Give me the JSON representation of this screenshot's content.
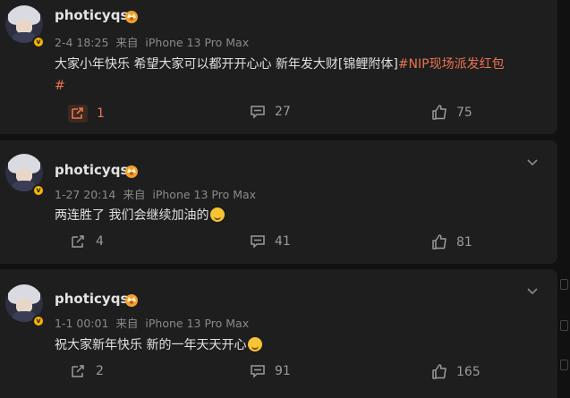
{
  "posts": [
    {
      "username": "photicyqs",
      "date": "2-4 18:25",
      "source_prefix": "来自",
      "source": "iPhone 13 Pro Max",
      "content_text": "大家小年快乐 希望大家可以都开开心心 新年发大财[锦鲤附体]",
      "hashtag_line1": "#NIP现场派发红包",
      "hashtag_line2": "#",
      "reposts": "1",
      "comments": "27",
      "likes": "75"
    },
    {
      "username": "photicyqs",
      "date": "1-27 20:14",
      "source_prefix": "来自",
      "source": "iPhone 13 Pro Max",
      "content_text": "两连胜了 我们会继续加油的",
      "reposts": "4",
      "comments": "41",
      "likes": "81"
    },
    {
      "username": "photicyqs",
      "date": "1-1 00:01",
      "source_prefix": "来自",
      "source": "iPhone 13 Pro Max",
      "content_text": "祝大家新年快乐 新的一年天天开心",
      "reposts": "2",
      "comments": "91",
      "likes": "165"
    }
  ],
  "icons": {
    "verified": "verified-badge-icon",
    "crown": "crown-icon",
    "repost": "repost-icon",
    "comment": "comment-icon",
    "like": "like-icon",
    "more": "chevron-down-icon"
  },
  "colors": {
    "background": "#111111",
    "card": "#1e1e1e",
    "hashtag": "#eb7350",
    "verified": "#f7b500"
  }
}
